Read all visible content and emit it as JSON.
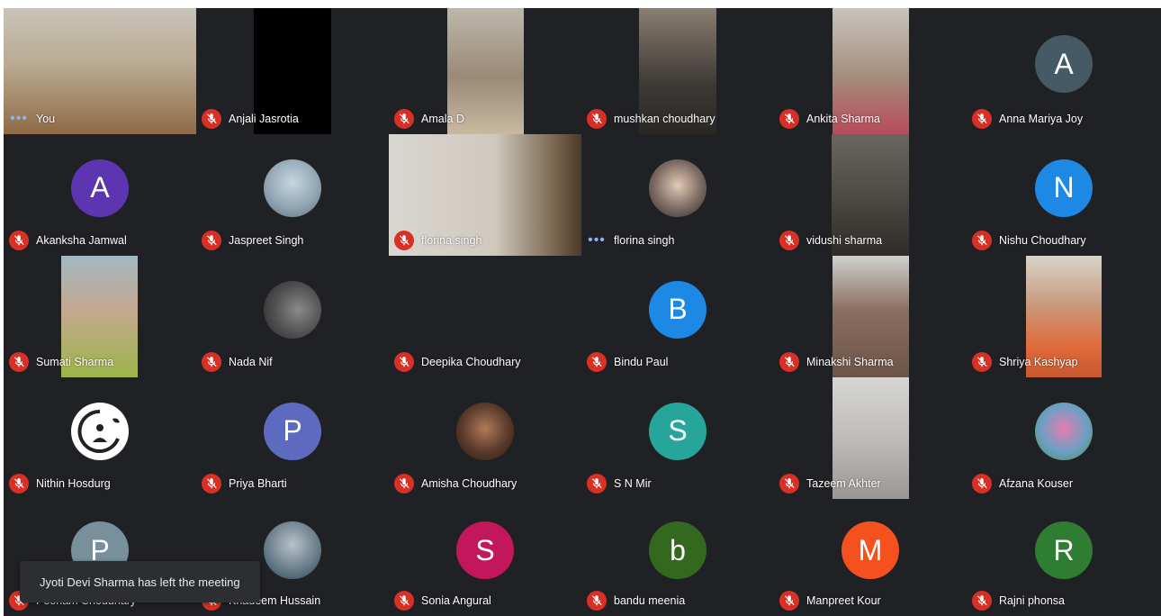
{
  "colors": {
    "background": "#202124",
    "mute_badge": "#d93025",
    "speaking_indicator": "#8ab4f8",
    "avatar_anna": "#455a64",
    "avatar_akanksha": "#5e35b1",
    "avatar_nishu": "#1e88e5",
    "avatar_bindu": "#1e88e5",
    "avatar_priya": "#5c6bc0",
    "avatar_sn": "#26a69a",
    "avatar_poonam": "#78909c",
    "avatar_sonia": "#c2185b",
    "avatar_bandu": "#33691e",
    "avatar_manpreet": "#f4511e",
    "avatar_rajni": "#2e7d32"
  },
  "icons": {
    "mute": "mic-off-icon",
    "speaking": "speaking-dots-icon"
  },
  "participants": [
    {
      "name": "You",
      "status": "speaking",
      "avatar": ""
    },
    {
      "name": "Anjali Jasrotia",
      "status": "muted",
      "avatar": ""
    },
    {
      "name": "Amala D",
      "status": "muted",
      "avatar": ""
    },
    {
      "name": "mushkan choudhary",
      "status": "muted",
      "avatar": ""
    },
    {
      "name": "Ankita Sharma",
      "status": "muted",
      "avatar": ""
    },
    {
      "name": "Anna Mariya Joy",
      "status": "muted",
      "avatar": "A"
    },
    {
      "name": "Akanksha Jamwal",
      "status": "muted",
      "avatar": "A"
    },
    {
      "name": "Jaspreet Singh",
      "status": "muted",
      "avatar": ""
    },
    {
      "name": "florina singh",
      "status": "muted",
      "avatar": ""
    },
    {
      "name": "florina singh",
      "status": "speaking",
      "avatar": ""
    },
    {
      "name": "vidushi sharma",
      "status": "muted",
      "avatar": ""
    },
    {
      "name": "Nishu Choudhary",
      "status": "muted",
      "avatar": "N"
    },
    {
      "name": "Sumati Sharma",
      "status": "muted",
      "avatar": ""
    },
    {
      "name": "Nada Nif",
      "status": "muted",
      "avatar": ""
    },
    {
      "name": "Deepika Choudhary",
      "status": "muted",
      "avatar": ""
    },
    {
      "name": "Bindu Paul",
      "status": "muted",
      "avatar": "B"
    },
    {
      "name": "Minakshi Sharma",
      "status": "muted",
      "avatar": ""
    },
    {
      "name": "Shriya Kashyap",
      "status": "muted",
      "avatar": ""
    },
    {
      "name": "Nithin Hosdurg",
      "status": "muted",
      "avatar": ""
    },
    {
      "name": "Priya Bharti",
      "status": "muted",
      "avatar": "P"
    },
    {
      "name": "Amisha Choudhary",
      "status": "muted",
      "avatar": ""
    },
    {
      "name": "S N Mir",
      "status": "muted",
      "avatar": "S"
    },
    {
      "name": "Tazeem Akhter",
      "status": "muted",
      "avatar": ""
    },
    {
      "name": "Afzana Kouser",
      "status": "muted",
      "avatar": ""
    },
    {
      "name": "Poonam Choudhary",
      "status": "muted",
      "avatar": "P"
    },
    {
      "name": "Khadeem Hussain",
      "status": "muted",
      "avatar": ""
    },
    {
      "name": "Sonia Angural",
      "status": "muted",
      "avatar": "S"
    },
    {
      "name": "bandu meenia",
      "status": "muted",
      "avatar": "b"
    },
    {
      "name": "Manpreet Kour",
      "status": "muted",
      "avatar": "M"
    },
    {
      "name": "Rajni phonsa",
      "status": "muted",
      "avatar": "R"
    }
  ],
  "toast": {
    "message": "Jyoti Devi Sharma has left the meeting"
  }
}
